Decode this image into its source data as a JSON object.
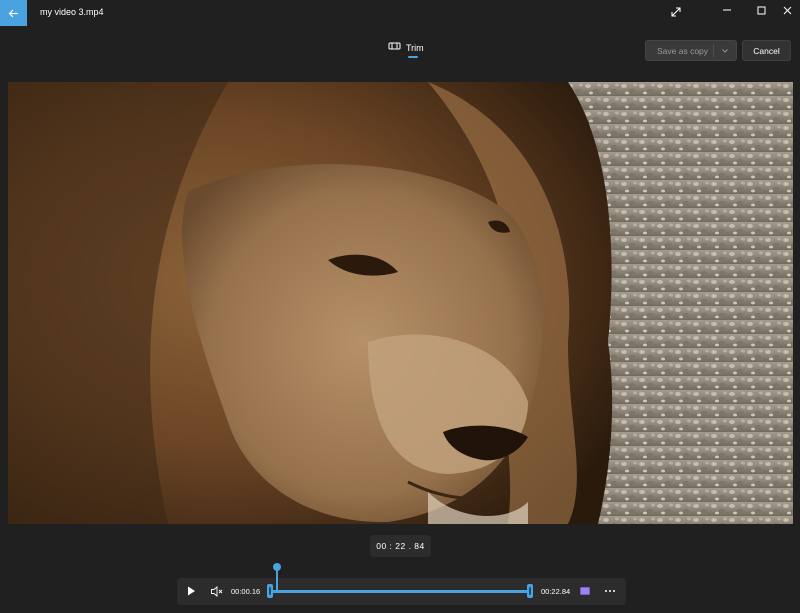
{
  "window": {
    "title": "my video 3.mp4"
  },
  "toolbar": {
    "trim_label": "Trim",
    "save_label": "Save as copy",
    "cancel_label": "Cancel"
  },
  "player": {
    "current_time": "00 : 22 . 84",
    "trim_start": "00:00.16",
    "trim_end": "00:22.84",
    "playhead_position_fraction": 0.03
  },
  "icons": {
    "back": "back-arrow-icon",
    "expand": "expand-icon",
    "trim": "trim-icon",
    "play": "play-icon",
    "mute": "volume-mute-icon",
    "clip": "clip-icon",
    "more": "more-icon"
  },
  "colors": {
    "accent": "#4aa3e0",
    "background": "#202020",
    "control_bg": "#2c2c2c"
  }
}
